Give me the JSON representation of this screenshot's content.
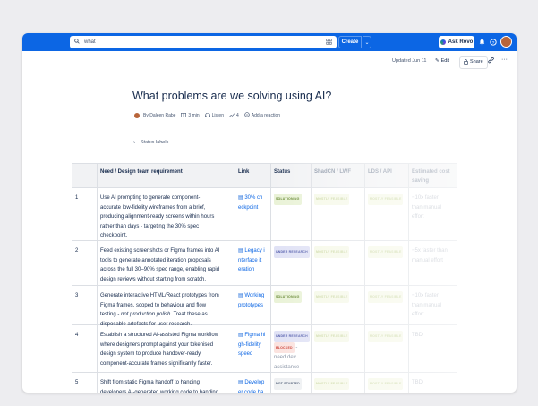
{
  "topbar": {
    "search_value": "what",
    "create_label": "Create",
    "ask_rovo_label": "Ask Rovo"
  },
  "pagebar": {
    "updated": "Updated Jun 11",
    "edit_label": "Edit",
    "share_label": "Share"
  },
  "page": {
    "title": "What problems are we solving using AI?",
    "author": "By Daleen Rabe",
    "read_time": "3 min",
    "listen_label": "Listen",
    "reactions_count": "4",
    "add_reaction_label": "Add a reaction",
    "status_labels": "Status labels"
  },
  "table": {
    "headers": [
      "Need / Design team requirement",
      "Link",
      "Status",
      "ShadCN / LWF",
      "LDS / API",
      "Estimated cost",
      "saving"
    ],
    "rows": [
      {
        "num": "1",
        "requirement": [
          "Use AI prompting to generate component-",
          "accurate low-fidelity wireframes from a brief,",
          "producing alignment-ready screens within hours",
          "rather than days - targeting the 30% spec",
          "checkpoint."
        ],
        "link": [
          "30% ch",
          "eckpoint"
        ],
        "status": "SOLUTIONING",
        "status_color": "#e9f2d6",
        "status_text": "#5b7f24",
        "shadcn": "MOSTLY FEASIBLE",
        "lds": "MOSTLY FEASIBLE",
        "cost": [
          "~10x faster",
          "than manual",
          "effort"
        ]
      },
      {
        "num": "2",
        "requirement": [
          "Feed existing screenshots or Figma frames into AI",
          "tools to generate annotated iteration proposals",
          "across the full 30–90% spec range, enabling rapid",
          "design reviews without starting from scratch."
        ],
        "link": [
          "Legacy i",
          "nterface it",
          "eration"
        ],
        "status": "UNDER RESEARCH",
        "status_color": "#dfe1f5",
        "status_text": "#4c56a8",
        "shadcn": "MOSTLY FEASIBLE",
        "lds": "MOSTLY FEASIBLE",
        "cost": [
          "~5x faster than",
          "manual effort"
        ]
      },
      {
        "num": "3",
        "requirement": [
          "Generate interactive HTML/React prototypes from",
          "Figma frames, scoped to behaviour and flow",
          "testing - not production polish. Treat these as",
          "disposable artefacts for user research."
        ],
        "italic": "not production polish",
        "link": [
          "Working",
          "prototypes"
        ],
        "status": "SOLUTIONING",
        "status_color": "#e9f2d6",
        "status_text": "#5b7f24",
        "shadcn": "MOSTLY FEASIBLE",
        "lds": "MOSTLY FEASIBLE",
        "cost": [
          "~10x faster",
          "than manual",
          "effort"
        ]
      },
      {
        "num": "4",
        "requirement": [
          "Establish a structured AI-assisted Figma workflow",
          "where designers prompt against your tokenised",
          "design system to produce handover-ready,",
          "component-accurate frames significantly faster."
        ],
        "link": [
          "Figma hi",
          "gh-fidelity",
          "speed"
        ],
        "status": "UNDER RESEARCH",
        "status_color": "#dfe1f5",
        "status_text": "#4c56a8",
        "status2": "BLOCKED",
        "status2_color": "#fbe2de",
        "status2_text": "#c9372c",
        "status_note": [
          "need dev",
          "assistance"
        ],
        "shadcn": "MOSTLY FEASIBLE",
        "lds": "MOSTLY FEASIBLE",
        "cost": [
          "TBD"
        ]
      },
      {
        "num": "5",
        "requirement": [
          "Shift from static Figma handoff to handing",
          "developers AI-generated working code to handing"
        ],
        "link": [
          "Develop",
          "er code ha"
        ],
        "status": "NOT STARTED",
        "status_color": "#eef0f2",
        "status_text": "#44546f",
        "shadcn": "MOSTLY FEASIBLE",
        "lds": "MOSTLY FEASIBLE",
        "cost": [
          "TBD"
        ]
      }
    ]
  }
}
